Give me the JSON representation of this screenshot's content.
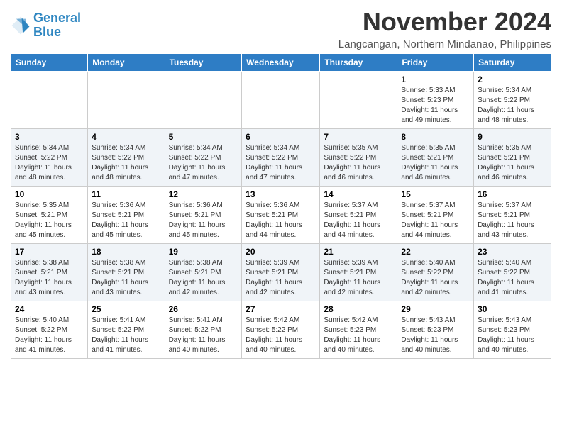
{
  "header": {
    "logo_line1": "General",
    "logo_line2": "Blue",
    "month_title": "November 2024",
    "location": "Langcangan, Northern Mindanao, Philippines"
  },
  "columns": [
    "Sunday",
    "Monday",
    "Tuesday",
    "Wednesday",
    "Thursday",
    "Friday",
    "Saturday"
  ],
  "weeks": [
    [
      {
        "day": "",
        "info": ""
      },
      {
        "day": "",
        "info": ""
      },
      {
        "day": "",
        "info": ""
      },
      {
        "day": "",
        "info": ""
      },
      {
        "day": "",
        "info": ""
      },
      {
        "day": "1",
        "info": "Sunrise: 5:33 AM\nSunset: 5:23 PM\nDaylight: 11 hours and 49 minutes."
      },
      {
        "day": "2",
        "info": "Sunrise: 5:34 AM\nSunset: 5:22 PM\nDaylight: 11 hours and 48 minutes."
      }
    ],
    [
      {
        "day": "3",
        "info": "Sunrise: 5:34 AM\nSunset: 5:22 PM\nDaylight: 11 hours and 48 minutes."
      },
      {
        "day": "4",
        "info": "Sunrise: 5:34 AM\nSunset: 5:22 PM\nDaylight: 11 hours and 48 minutes."
      },
      {
        "day": "5",
        "info": "Sunrise: 5:34 AM\nSunset: 5:22 PM\nDaylight: 11 hours and 47 minutes."
      },
      {
        "day": "6",
        "info": "Sunrise: 5:34 AM\nSunset: 5:22 PM\nDaylight: 11 hours and 47 minutes."
      },
      {
        "day": "7",
        "info": "Sunrise: 5:35 AM\nSunset: 5:22 PM\nDaylight: 11 hours and 46 minutes."
      },
      {
        "day": "8",
        "info": "Sunrise: 5:35 AM\nSunset: 5:21 PM\nDaylight: 11 hours and 46 minutes."
      },
      {
        "day": "9",
        "info": "Sunrise: 5:35 AM\nSunset: 5:21 PM\nDaylight: 11 hours and 46 minutes."
      }
    ],
    [
      {
        "day": "10",
        "info": "Sunrise: 5:35 AM\nSunset: 5:21 PM\nDaylight: 11 hours and 45 minutes."
      },
      {
        "day": "11",
        "info": "Sunrise: 5:36 AM\nSunset: 5:21 PM\nDaylight: 11 hours and 45 minutes."
      },
      {
        "day": "12",
        "info": "Sunrise: 5:36 AM\nSunset: 5:21 PM\nDaylight: 11 hours and 45 minutes."
      },
      {
        "day": "13",
        "info": "Sunrise: 5:36 AM\nSunset: 5:21 PM\nDaylight: 11 hours and 44 minutes."
      },
      {
        "day": "14",
        "info": "Sunrise: 5:37 AM\nSunset: 5:21 PM\nDaylight: 11 hours and 44 minutes."
      },
      {
        "day": "15",
        "info": "Sunrise: 5:37 AM\nSunset: 5:21 PM\nDaylight: 11 hours and 44 minutes."
      },
      {
        "day": "16",
        "info": "Sunrise: 5:37 AM\nSunset: 5:21 PM\nDaylight: 11 hours and 43 minutes."
      }
    ],
    [
      {
        "day": "17",
        "info": "Sunrise: 5:38 AM\nSunset: 5:21 PM\nDaylight: 11 hours and 43 minutes."
      },
      {
        "day": "18",
        "info": "Sunrise: 5:38 AM\nSunset: 5:21 PM\nDaylight: 11 hours and 43 minutes."
      },
      {
        "day": "19",
        "info": "Sunrise: 5:38 AM\nSunset: 5:21 PM\nDaylight: 11 hours and 42 minutes."
      },
      {
        "day": "20",
        "info": "Sunrise: 5:39 AM\nSunset: 5:21 PM\nDaylight: 11 hours and 42 minutes."
      },
      {
        "day": "21",
        "info": "Sunrise: 5:39 AM\nSunset: 5:21 PM\nDaylight: 11 hours and 42 minutes."
      },
      {
        "day": "22",
        "info": "Sunrise: 5:40 AM\nSunset: 5:22 PM\nDaylight: 11 hours and 42 minutes."
      },
      {
        "day": "23",
        "info": "Sunrise: 5:40 AM\nSunset: 5:22 PM\nDaylight: 11 hours and 41 minutes."
      }
    ],
    [
      {
        "day": "24",
        "info": "Sunrise: 5:40 AM\nSunset: 5:22 PM\nDaylight: 11 hours and 41 minutes."
      },
      {
        "day": "25",
        "info": "Sunrise: 5:41 AM\nSunset: 5:22 PM\nDaylight: 11 hours and 41 minutes."
      },
      {
        "day": "26",
        "info": "Sunrise: 5:41 AM\nSunset: 5:22 PM\nDaylight: 11 hours and 40 minutes."
      },
      {
        "day": "27",
        "info": "Sunrise: 5:42 AM\nSunset: 5:22 PM\nDaylight: 11 hours and 40 minutes."
      },
      {
        "day": "28",
        "info": "Sunrise: 5:42 AM\nSunset: 5:23 PM\nDaylight: 11 hours and 40 minutes."
      },
      {
        "day": "29",
        "info": "Sunrise: 5:43 AM\nSunset: 5:23 PM\nDaylight: 11 hours and 40 minutes."
      },
      {
        "day": "30",
        "info": "Sunrise: 5:43 AM\nSunset: 5:23 PM\nDaylight: 11 hours and 40 minutes."
      }
    ]
  ]
}
